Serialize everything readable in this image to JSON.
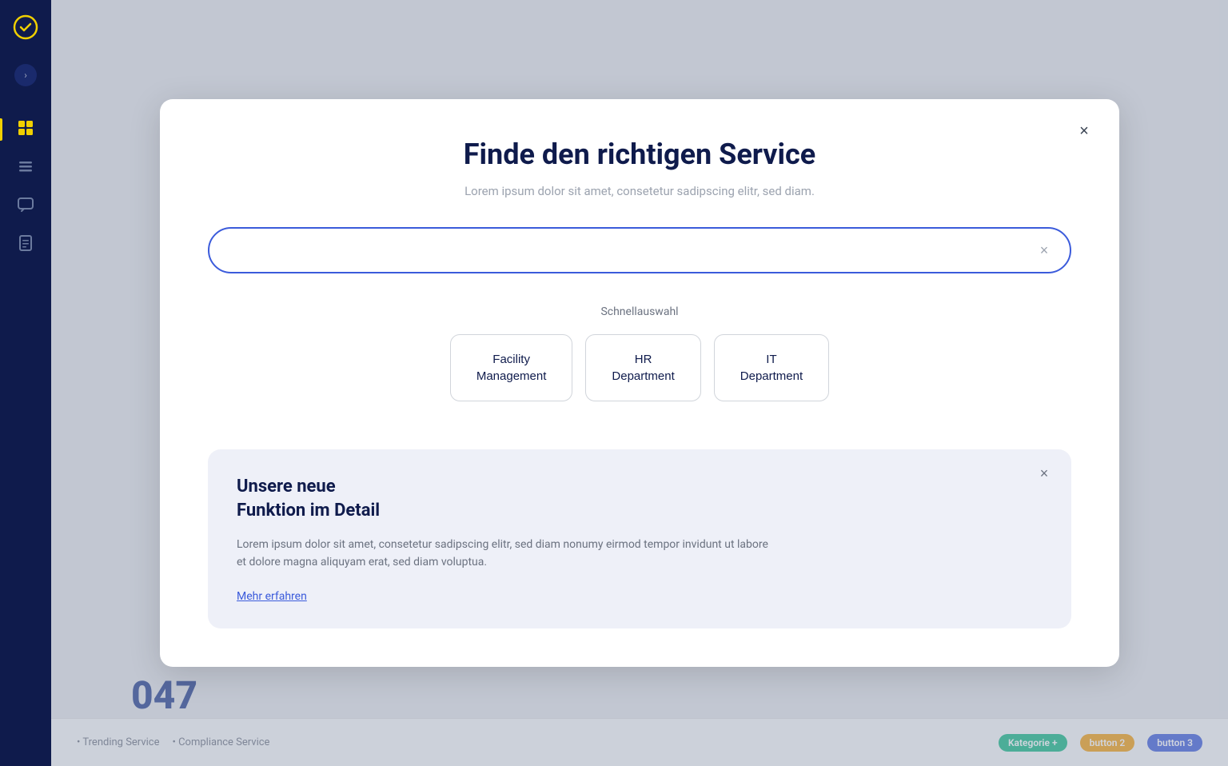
{
  "sidebar": {
    "logo_label": "App Logo",
    "toggle_icon": "›",
    "items": [
      {
        "id": "dashboard",
        "icon": "⊞",
        "label": "Dashboard",
        "active": true
      },
      {
        "id": "list",
        "icon": "☰",
        "label": "List",
        "active": false
      },
      {
        "id": "chat",
        "icon": "💬",
        "label": "Chat",
        "active": false
      },
      {
        "id": "reports",
        "icon": "☰",
        "label": "Reports",
        "active": false
      }
    ]
  },
  "modal": {
    "title": "Finde den richtigen Service",
    "subtitle": "Lorem ipsum dolor sit amet, consetetur sadipscing elitr, sed diam.",
    "close_icon": "×",
    "search": {
      "placeholder": "",
      "clear_icon": "×"
    },
    "quick_select": {
      "label": "Schnellauswahl",
      "options": [
        {
          "id": "facility",
          "label": "Facility\nManagement"
        },
        {
          "id": "hr",
          "label": "HR\nDepartment"
        },
        {
          "id": "it",
          "label": "IT\nDepartment"
        }
      ]
    },
    "info_card": {
      "title": "Unsere neue\nFunktion im Detail",
      "close_icon": "×",
      "text": "Lorem ipsum dolor sit amet, consetetur sadipscing elitr, sed  diam nonumy eirmod tempor invidunt ut labore et dolore magna aliquyam erat, sed diam voluptua.",
      "link_label": "Mehr erfahren"
    }
  },
  "background": {
    "big_number": "047",
    "bottom_badges": [
      "Kategorie +",
      "button 2",
      "button 3"
    ],
    "bottom_texts": [
      "• Trending Service",
      "• Compliance Service"
    ]
  }
}
